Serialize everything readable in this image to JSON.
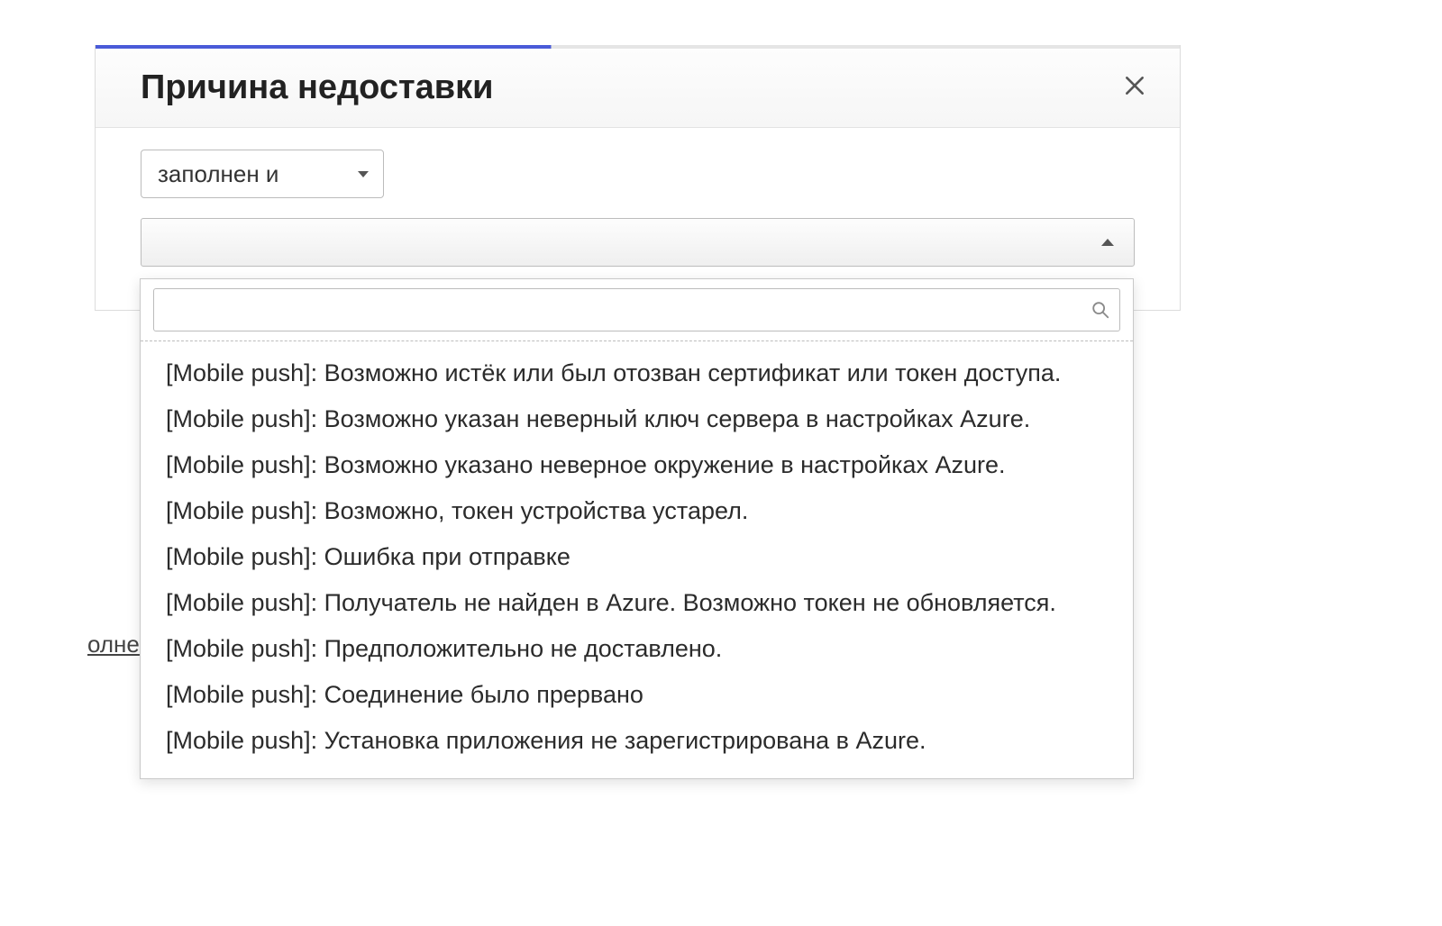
{
  "background": {
    "link_fragment": "олне"
  },
  "panel": {
    "title": "Причина недоставки",
    "condition_select": {
      "value": "заполнен и"
    },
    "reason_select": {
      "value": ""
    }
  },
  "dropdown": {
    "search_value": "",
    "items": [
      "[Mobile push]: Возможно истёк или был отозван сертификат или токен доступа.",
      "[Mobile push]: Возможно указан неверный ключ сервера в настройках Azure.",
      "[Mobile push]: Возможно указано неверное окружение в настройках Azure.",
      "[Mobile push]: Возможно, токен устройства устарел.",
      "[Mobile push]: Ошибка при отправке",
      "[Mobile push]: Получатель не найден в Azure. Возможно токен не обновляется.",
      "[Mobile push]: Предположительно не доставлено.",
      "[Mobile push]: Соединение было прервано",
      "[Mobile push]: Установка приложения не зарегистрирована в Azure."
    ]
  }
}
